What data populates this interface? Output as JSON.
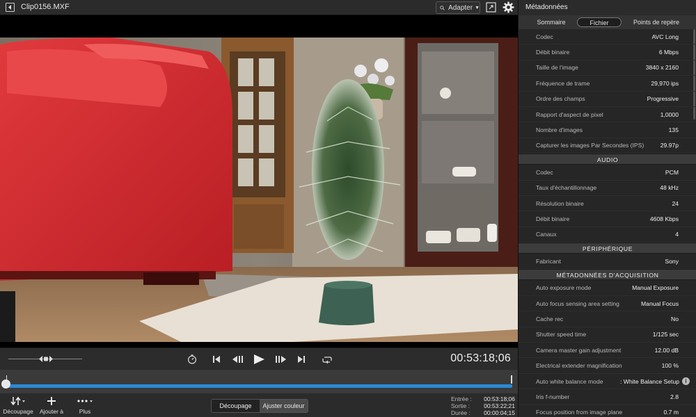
{
  "header": {
    "clip_title": "Clip0156.MXF",
    "fit_label": "Adapter"
  },
  "player": {
    "timecode": "00:53:18;06"
  },
  "bottom": {
    "tools": [
      {
        "label": "Découpage"
      },
      {
        "label": "Ajouter à"
      },
      {
        "label": "Plus"
      }
    ],
    "modes": [
      {
        "label": "Découpage",
        "active": true
      },
      {
        "label": "Ajuster couleur",
        "active": false
      }
    ],
    "in_label": "Entrée :",
    "in_value": "00:53:18;06",
    "out_label": "Sortie :",
    "out_value": "00:53:22;21",
    "dur_label": "Durée :",
    "dur_value": "00:00:04;15"
  },
  "panel": {
    "title": "Métadonnées",
    "tabs": [
      "Sommaire",
      "Fichier",
      "Points de repère"
    ],
    "active_tab": "Fichier",
    "video_rows": [
      {
        "k": "Codec",
        "v": "AVC Long"
      },
      {
        "k": "Débit binaire",
        "v": "6 Mbps"
      },
      {
        "k": "Taille de l'image",
        "v": "3840 x 2160"
      },
      {
        "k": "Fréquence de trame",
        "v": "29,970 ips"
      },
      {
        "k": "Ordre des champs",
        "v": "Progressive"
      },
      {
        "k": "Rapport d'aspect de pixel",
        "v": "1,0000"
      },
      {
        "k": "Nombre d'images",
        "v": "135"
      },
      {
        "k": "Capturer les images Par Secondes (IPS)",
        "v": "29.97p"
      }
    ],
    "audio_title": "AUDIO",
    "audio_rows": [
      {
        "k": "Codec",
        "v": "PCM"
      },
      {
        "k": "Taux d'échantillonnage",
        "v": "48 kHz"
      },
      {
        "k": "Résolution binaire",
        "v": "24"
      },
      {
        "k": "Débit binaire",
        "v": "4608 Kbps"
      },
      {
        "k": "Canaux",
        "v": "4"
      }
    ],
    "device_title": "PÉRIPHÉRIQUE",
    "device_rows": [
      {
        "k": "Fabricant",
        "v": "Sony"
      }
    ],
    "acq_title": "MÉTADONNÉES D'ACQUISITION",
    "acq_rows": [
      {
        "k": "Auto exposure mode",
        "v": "Manual Exposure"
      },
      {
        "k": "Auto focus sensing area setting",
        "v": "Manual Focus"
      },
      {
        "k": "Cache rec",
        "v": "No"
      },
      {
        "k": "Shutter speed time",
        "v": "1/125 sec"
      },
      {
        "k": "Camera master gain adjustment",
        "v": "12.00 dB"
      },
      {
        "k": "Electrical extender magnification",
        "v": "100 %"
      },
      {
        "k": "Auto white balance mode",
        "v": ": White Balance Setup"
      },
      {
        "k": "Iris f-number",
        "v": "2.8"
      },
      {
        "k": "Focus position from image plane",
        "v": "0.7 m"
      }
    ]
  },
  "colors": {
    "accent": "#2a8ad6",
    "sofa": "#d8252a"
  },
  "timeline": {
    "playhead_fraction": 0.0
  }
}
